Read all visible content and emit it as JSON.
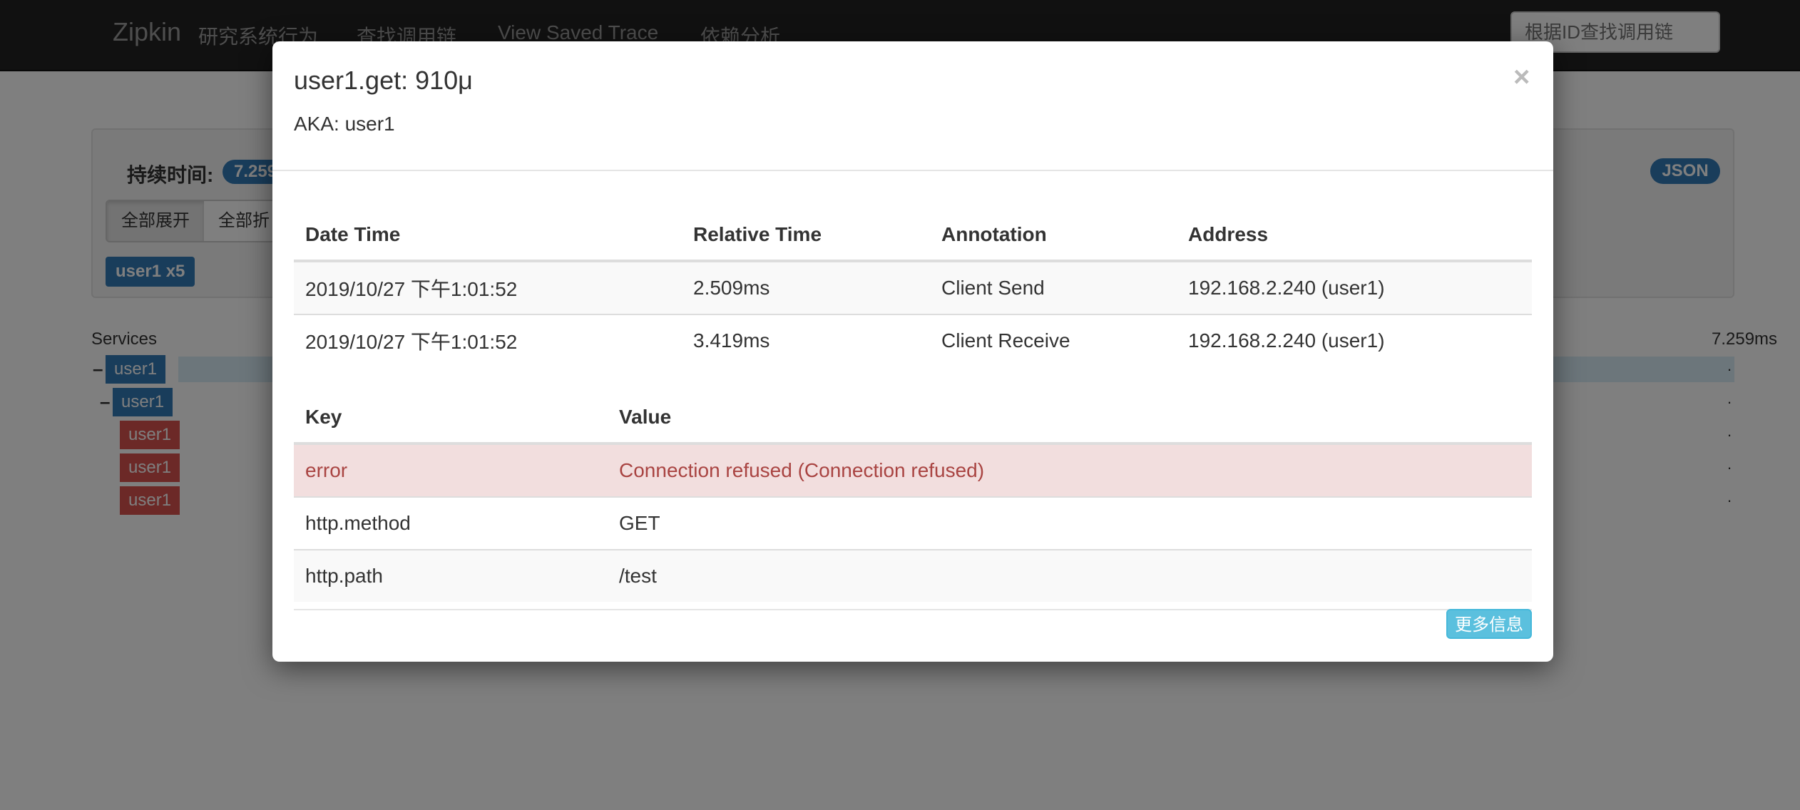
{
  "navbar": {
    "brand": "Zipkin",
    "links": [
      "研究系统行为",
      "查找调用链",
      "View Saved Trace",
      "依赖分析"
    ],
    "search_placeholder": "根据ID查找调用链"
  },
  "trace_panel": {
    "duration_label": "持续时间:",
    "duration_value": "7.259",
    "json_label": "JSON",
    "buttons": [
      "全部展开",
      "全部折"
    ],
    "service_badge": "user1 x5"
  },
  "timeline": {
    "services_heading": "Services",
    "total_duration": "7.259ms",
    "rows": [
      {
        "service": "user1",
        "status": "ok",
        "dot": "."
      },
      {
        "service": "user1",
        "status": "ok",
        "dot": "."
      },
      {
        "service": "user1",
        "status": "error",
        "dot": "."
      },
      {
        "service": "user1",
        "status": "error",
        "dot": "."
      },
      {
        "service": "user1",
        "status": "error",
        "dot": "."
      }
    ],
    "expanders": [
      "–",
      "–"
    ]
  },
  "modal": {
    "title": "user1.get: 910μ",
    "aka": "AKA: user1",
    "close_symbol": "×",
    "annotations_table": {
      "headers": [
        "Date Time",
        "Relative Time",
        "Annotation",
        "Address"
      ],
      "rows": [
        [
          "2019/10/27 下午1:01:52",
          "2.509ms",
          "Client Send",
          "192.168.2.240 (user1)"
        ],
        [
          "2019/10/27 下午1:01:52",
          "3.419ms",
          "Client Receive",
          "192.168.2.240 (user1)"
        ]
      ]
    },
    "tags_table": {
      "headers": [
        "Key",
        "Value"
      ],
      "rows": [
        [
          "error",
          "Connection refused (Connection refused)"
        ],
        [
          "http.method",
          "GET"
        ],
        [
          "http.path",
          "/test"
        ]
      ]
    },
    "more_info_label": "更多信息"
  },
  "colors": {
    "primary": "#337ab7",
    "danger": "#d9534f",
    "info": "#5bc0de",
    "danger_row_bg": "#f2dede",
    "danger_text": "#a94442",
    "navbar_bg": "#222222"
  }
}
